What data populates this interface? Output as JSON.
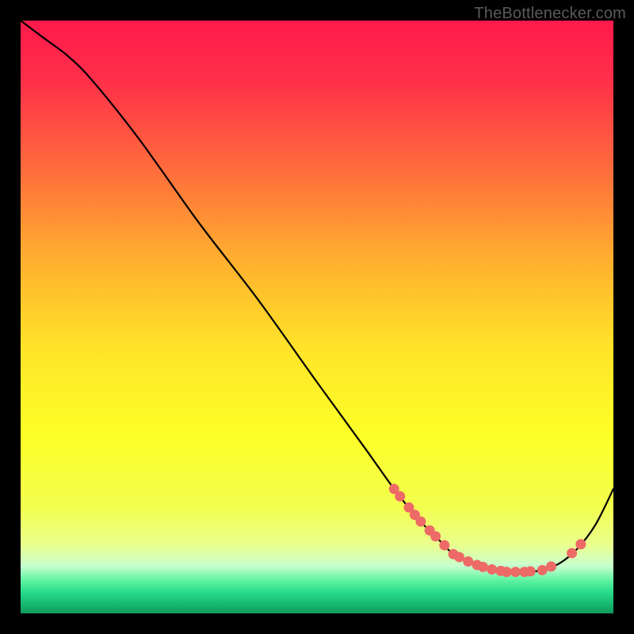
{
  "attribution": "TheBottlenecker.com",
  "chart_data": {
    "type": "line",
    "title": "",
    "xlabel": "",
    "ylabel": "",
    "xlim": [
      0,
      100
    ],
    "ylim": [
      0,
      100
    ],
    "series": [
      {
        "name": "curve",
        "x": [
          0,
          4,
          8,
          12,
          20,
          30,
          40,
          50,
          58,
          63,
          67,
          70,
          73,
          76,
          79,
          82,
          85,
          88,
          91,
          94,
          97,
          100
        ],
        "y": [
          100,
          97,
          94,
          90,
          80,
          66,
          53,
          39,
          28,
          21,
          16,
          13,
          10,
          8.5,
          7.5,
          7,
          7,
          7.3,
          8.5,
          11,
          15,
          21
        ]
      }
    ],
    "markers_x": [
      63,
      64,
      65.5,
      66.5,
      67.5,
      69,
      70,
      71.5,
      73,
      74,
      75.5,
      77,
      78,
      79.5,
      81,
      82,
      83.5,
      85,
      86,
      88,
      89.5,
      93,
      94.5
    ],
    "marker_color": "#ed6a66",
    "curve_color": "#000000",
    "gradient_stops": [
      {
        "offset": 0.0,
        "color": "#ff1a4b"
      },
      {
        "offset": 0.1,
        "color": "#ff2f49"
      },
      {
        "offset": 0.25,
        "color": "#ff6c3c"
      },
      {
        "offset": 0.4,
        "color": "#ffae2f"
      },
      {
        "offset": 0.55,
        "color": "#ffe329"
      },
      {
        "offset": 0.7,
        "color": "#fdff28"
      },
      {
        "offset": 0.82,
        "color": "#f2ff4e"
      },
      {
        "offset": 0.885,
        "color": "#eaff8f"
      },
      {
        "offset": 0.92,
        "color": "#c8ffcf"
      },
      {
        "offset": 0.945,
        "color": "#5cf2a1"
      },
      {
        "offset": 0.965,
        "color": "#27d98a"
      },
      {
        "offset": 0.985,
        "color": "#17b770"
      },
      {
        "offset": 1.0,
        "color": "#0f9a5c"
      }
    ]
  }
}
